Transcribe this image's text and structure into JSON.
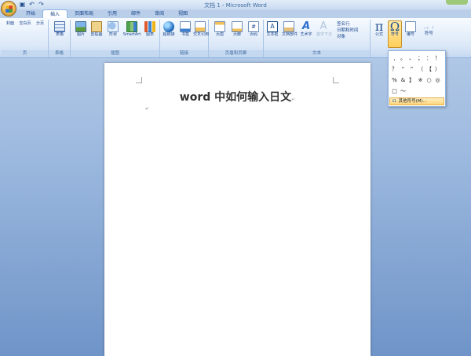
{
  "window": {
    "title": "文档 1 - Microsoft Word"
  },
  "tabs": [
    "开始",
    "插入",
    "页面布局",
    "引用",
    "邮件",
    "审阅",
    "视图"
  ],
  "ribbon": {
    "groups": {
      "pages": "页",
      "tables": "表格",
      "illustrations": "插图",
      "links": "链接",
      "header_footer": "页眉和页脚",
      "text": "文本"
    },
    "buttons": {
      "cover": "封面",
      "blank": "空白页",
      "break": "分页",
      "table": "表格",
      "picture": "图片",
      "clipart": "剪贴画",
      "shapes": "形状",
      "smartart": "SmartArt",
      "chart": "图表",
      "hyperlink": "超链接",
      "bookmark": "书签",
      "crossref": "交叉引用",
      "header": "页眉",
      "footer": "页脚",
      "pagenum": "页码",
      "textbox": "文本框",
      "quickparts": "文档部件",
      "wordart": "艺术字",
      "dropcap": "首字下沉",
      "signature": "签名行",
      "datetime": "日期和时间",
      "object": "对象",
      "equation": "公式",
      "symbol": "符号",
      "number": "编号",
      "symbol2": "符号"
    }
  },
  "symbol_panel": {
    "symbols": [
      ",",
      "。",
      "、",
      "；",
      "：",
      "！",
      "？",
      "“",
      "”",
      "（",
      "【",
      "）",
      "%",
      "&",
      "】",
      "※",
      "○",
      "◎",
      "□",
      "～"
    ],
    "more_label": "其他符号(M)..."
  },
  "document": {
    "title": "word 中如何输入日文",
    "para_mark": "↵",
    "enter_mark": "↵"
  }
}
